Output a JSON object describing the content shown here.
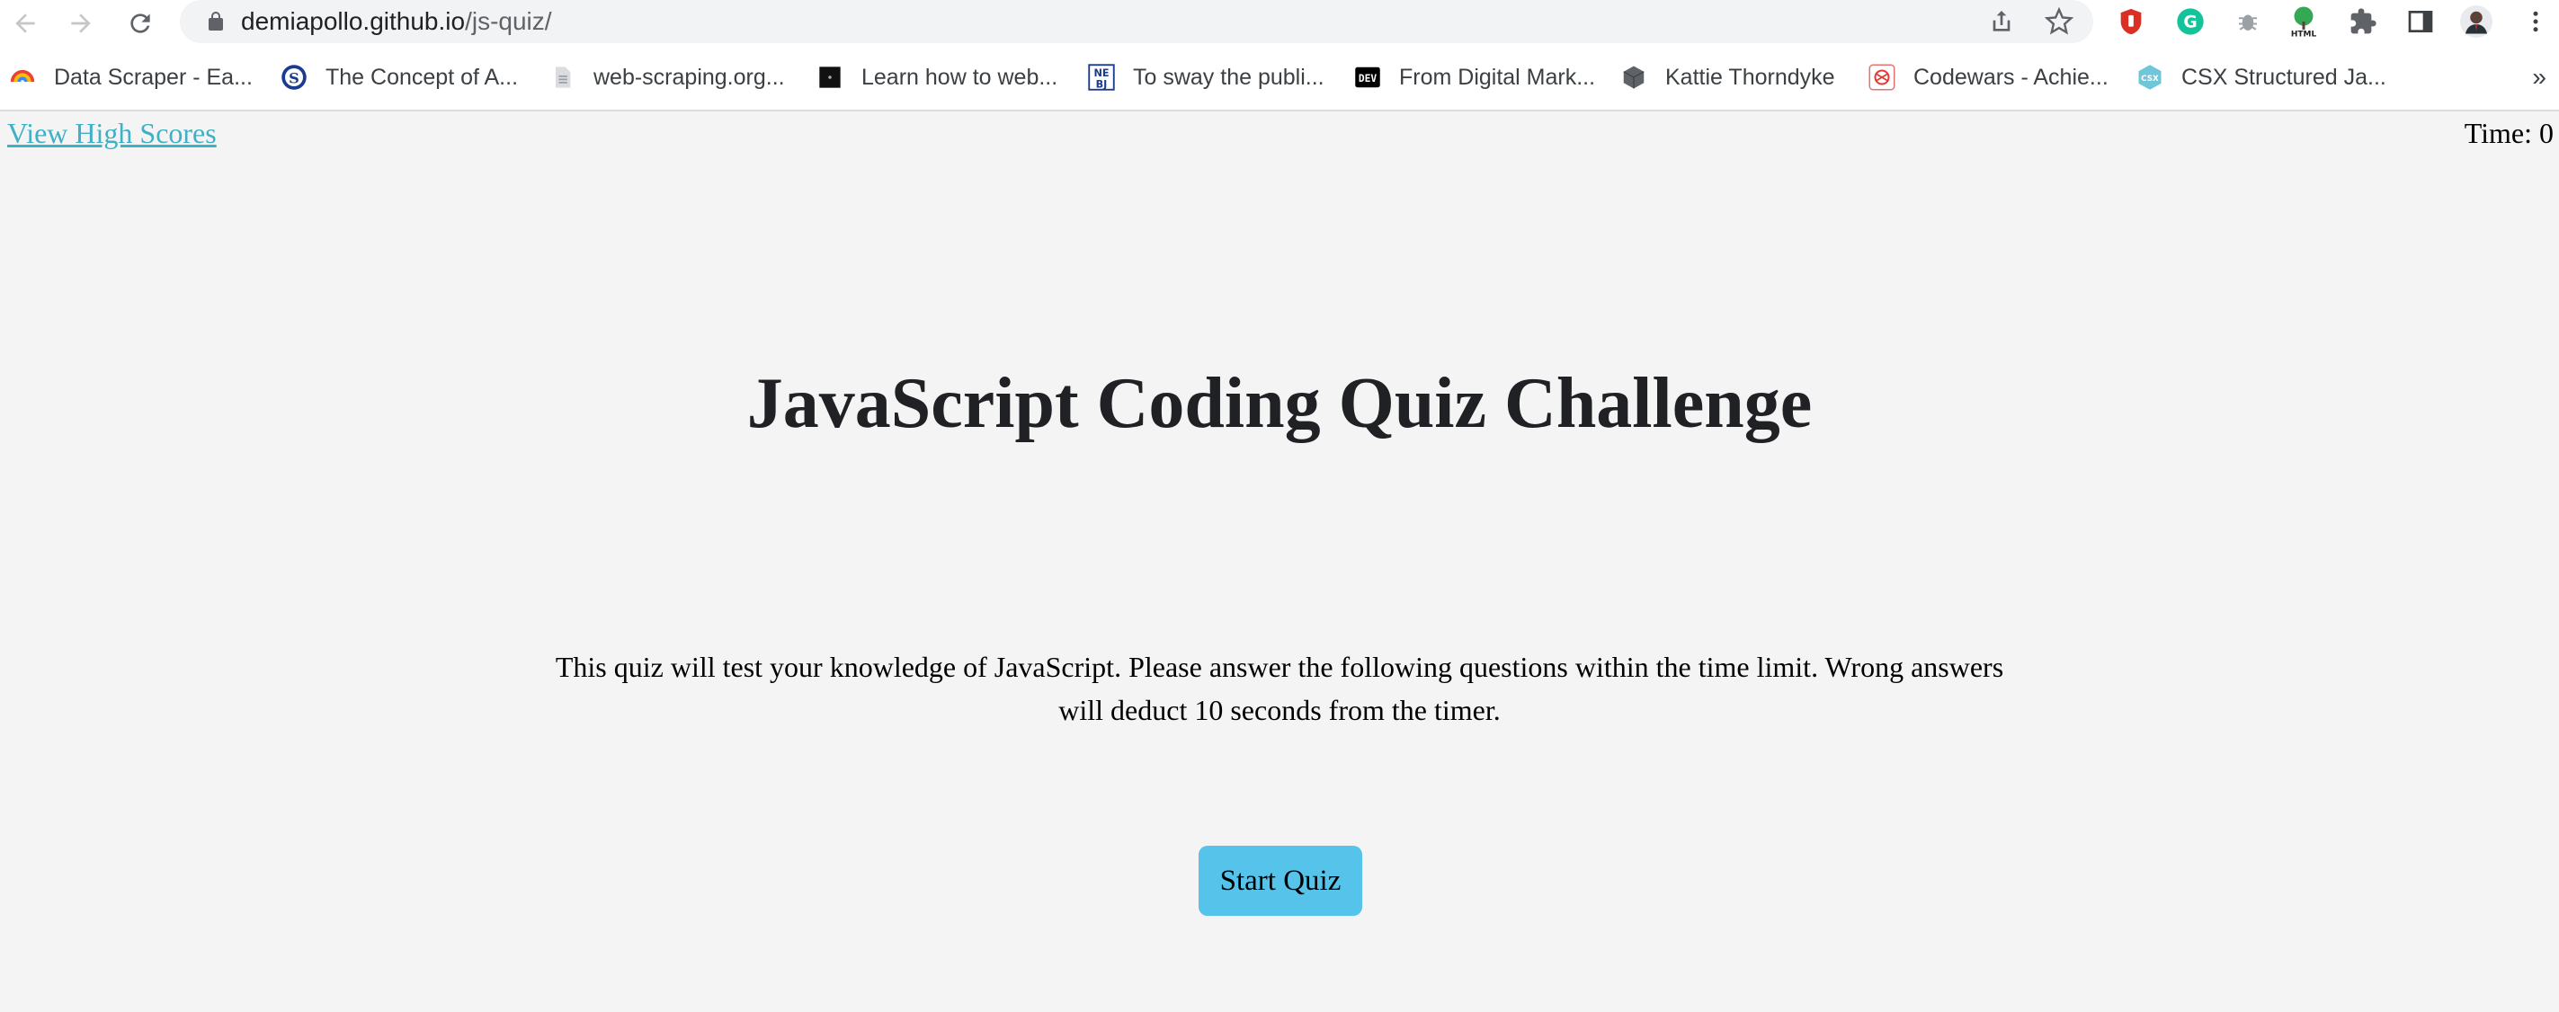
{
  "browser": {
    "url_host": "demiapollo.github.io",
    "url_path": "/js-quiz/",
    "nav_icons": [
      "back-arrow-icon",
      "forward-arrow-icon",
      "reload-icon"
    ],
    "omnibox_actions": [
      "share-icon",
      "bookmark-star-icon"
    ],
    "extensions": [
      "ublock-icon",
      "grammarly-icon",
      "bug-icon",
      "html-tree-icon",
      "puzzle-icon",
      "side-panel-icon",
      "profile-avatar-icon",
      "kebab-menu-icon"
    ]
  },
  "bookmarks": {
    "items": [
      {
        "label": "Data Scraper - Ea...",
        "icon": "data-scraper-icon"
      },
      {
        "label": "The Concept of A...",
        "icon": "s-circle-icon"
      },
      {
        "label": "web-scraping.org...",
        "icon": "document-icon"
      },
      {
        "label": "Learn how to web...",
        "icon": "terminal-icon"
      },
      {
        "label": "To sway the publi...",
        "icon": "nbj-icon"
      },
      {
        "label": "From Digital Mark...",
        "icon": "dev-icon"
      },
      {
        "label": "Kattie Thorndyke",
        "icon": "cube-icon"
      },
      {
        "label": "Codewars - Achie...",
        "icon": "codewars-icon"
      },
      {
        "label": "CSX Structured Ja...",
        "icon": "csx-icon"
      }
    ],
    "more": "»"
  },
  "page": {
    "highscores_link": "View High Scores",
    "timer_label": "Time: 0",
    "title": "JavaScript Coding Quiz Challenge",
    "description": "This quiz will test your knowledge of JavaScript. Please answer the following questions within the time limit. Wrong answers will deduct 10 seconds from the timer.",
    "start_button": "Start Quiz"
  },
  "colors": {
    "page_background": "#f4f4f4",
    "link": "#3fb0c6",
    "button": "#56c4ea",
    "title": "#202124"
  }
}
